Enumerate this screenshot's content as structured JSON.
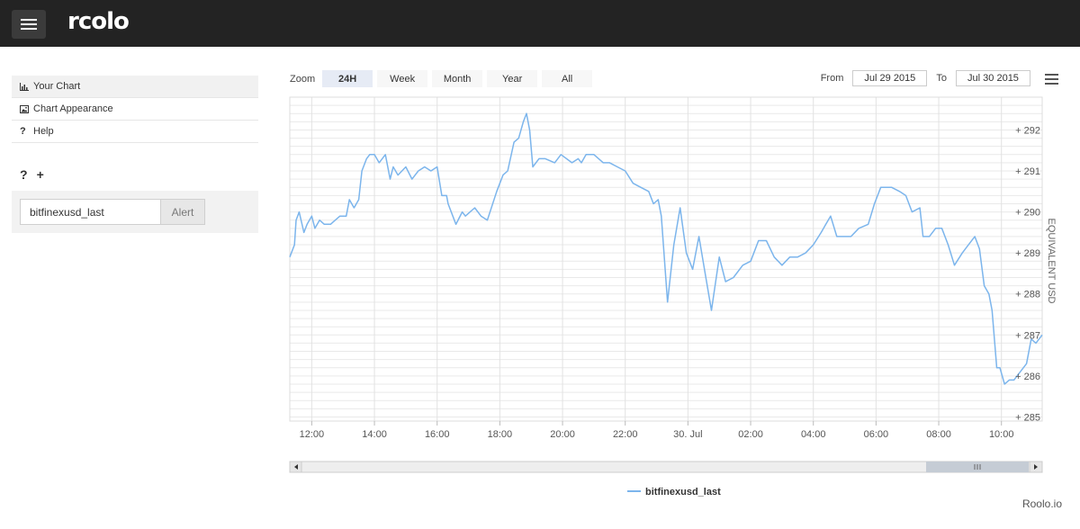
{
  "app": {
    "logo_text": "rcolo",
    "brand": "Roolo.io"
  },
  "sidebar": {
    "items": [
      {
        "label": "Your Chart",
        "icon": "bar-chart-icon"
      },
      {
        "label": "Chart Appearance",
        "icon": "image-icon"
      },
      {
        "label": "Help",
        "icon": "question-icon"
      }
    ],
    "tools": {
      "help": "?",
      "add": "+"
    },
    "alert": {
      "input_value": "bitfinexusd_last",
      "button_label": "Alert"
    }
  },
  "toolbar": {
    "zoom_label": "Zoom",
    "zoom_options": [
      "24H",
      "Week",
      "Month",
      "Year",
      "All"
    ],
    "zoom_active": "24H",
    "from_label": "From",
    "from_value": "Jul 29 2015",
    "to_label": "To",
    "to_value": "Jul 30 2015"
  },
  "colors": {
    "series": "#7cb5ec",
    "topbar": "#232323"
  },
  "chart_data": {
    "type": "line",
    "ylabel": "EQUIVALENT USD",
    "y_axis_side": "right",
    "ylim": [
      284.9,
      292.8
    ],
    "y_ticks": [
      285,
      286,
      287,
      288,
      289,
      290,
      291,
      292
    ],
    "y_tick_labels": [
      "+ 285",
      "+ 286",
      "+ 287",
      "+ 288",
      "+ 289",
      "+ 290",
      "+ 291",
      "+ 292"
    ],
    "x_tick_labels": [
      "12:00",
      "14:00",
      "16:00",
      "18:00",
      "20:00",
      "22:00",
      "30. Jul",
      "02:00",
      "04:00",
      "06:00",
      "08:00",
      "10:00"
    ],
    "xlim_hours": [
      11.3,
      35.3
    ],
    "grid": true,
    "legend": "bottom-center",
    "series": [
      {
        "name": "bitfinexusd_last",
        "x_hours": [
          11.3,
          11.45,
          11.5,
          11.6,
          11.75,
          11.85,
          12.0,
          12.1,
          12.25,
          12.4,
          12.6,
          12.75,
          12.9,
          13.1,
          13.2,
          13.35,
          13.5,
          13.6,
          13.75,
          13.85,
          14.0,
          14.15,
          14.35,
          14.5,
          14.6,
          14.75,
          15.0,
          15.2,
          15.4,
          15.6,
          15.8,
          16.0,
          16.15,
          16.3,
          16.35,
          16.6,
          16.8,
          16.9,
          17.05,
          17.2,
          17.4,
          17.6,
          17.9,
          18.0,
          18.1,
          18.25,
          18.45,
          18.6,
          18.75,
          18.85,
          18.95,
          19.05,
          19.25,
          19.45,
          19.75,
          19.95,
          20.3,
          20.5,
          20.6,
          20.75,
          21.0,
          21.3,
          21.5,
          21.75,
          22.0,
          22.25,
          22.5,
          22.75,
          22.9,
          23.05,
          23.15,
          23.35,
          23.55,
          23.75,
          23.95,
          24.15,
          24.35,
          24.55,
          24.75,
          25.0,
          25.2,
          25.45,
          25.75,
          26.0,
          26.25,
          26.5,
          26.75,
          27.0,
          27.25,
          27.5,
          27.75,
          28.0,
          28.25,
          28.4,
          28.55,
          28.75,
          28.95,
          29.2,
          29.45,
          29.75,
          29.95,
          30.15,
          30.5,
          30.75,
          30.95,
          31.15,
          31.4,
          31.5,
          31.7,
          31.9,
          32.1,
          32.3,
          32.5,
          32.75,
          32.95,
          33.15,
          33.3,
          33.45,
          33.6,
          33.7,
          33.85,
          33.95,
          34.1,
          34.25,
          34.4,
          34.6,
          34.8,
          34.95,
          35.1,
          35.3
        ],
        "y_values": [
          288.9,
          289.2,
          289.8,
          290.0,
          289.5,
          289.7,
          289.9,
          289.6,
          289.8,
          289.7,
          289.7,
          289.8,
          289.9,
          289.9,
          290.3,
          290.1,
          290.3,
          291.0,
          291.3,
          291.4,
          291.4,
          291.2,
          291.4,
          290.8,
          291.1,
          290.9,
          291.1,
          290.8,
          291.0,
          291.1,
          291.0,
          291.1,
          290.4,
          290.4,
          290.2,
          289.7,
          290.0,
          289.9,
          290.0,
          290.1,
          289.9,
          289.8,
          290.5,
          290.7,
          290.9,
          291.0,
          291.7,
          291.8,
          292.2,
          292.4,
          292.0,
          291.1,
          291.3,
          291.3,
          291.2,
          291.4,
          291.2,
          291.3,
          291.2,
          291.4,
          291.4,
          291.2,
          291.2,
          291.1,
          291.0,
          290.7,
          290.6,
          290.5,
          290.2,
          290.3,
          289.9,
          287.8,
          289.2,
          290.1,
          289.0,
          288.6,
          289.4,
          288.5,
          287.6,
          288.9,
          288.3,
          288.4,
          288.7,
          288.8,
          289.3,
          289.3,
          288.9,
          288.7,
          288.9,
          288.9,
          289.0,
          289.2,
          289.5,
          289.7,
          289.9,
          289.4,
          289.4,
          289.4,
          289.6,
          289.7,
          290.2,
          290.6,
          290.6,
          290.5,
          290.4,
          290.0,
          290.1,
          289.4,
          289.4,
          289.6,
          289.6,
          289.2,
          288.7,
          289.0,
          289.2,
          289.4,
          289.1,
          288.2,
          288.0,
          287.6,
          286.2,
          286.2,
          285.8,
          285.9,
          285.9,
          286.1,
          286.3,
          286.9,
          286.8,
          287.0,
          286.9,
          286.5
        ]
      }
    ]
  }
}
